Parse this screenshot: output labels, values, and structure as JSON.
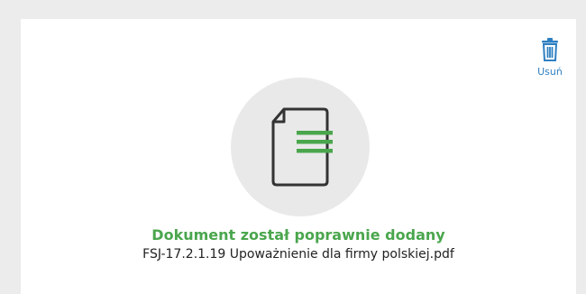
{
  "upload_card": {
    "delete_label": "Usuń",
    "delete_icon": "trash-icon",
    "document_icon": "document-icon",
    "status_text": "Dokument został poprawnie dodany",
    "file_name": "FSJ-17.2.1.19 Upoważnienie dla firmy polskiej.pdf"
  },
  "colors": {
    "accent_blue": "#2e7fc1",
    "success_green": "#4aa64d",
    "circle_bg": "#e9e9e9",
    "icon_dark": "#333333"
  }
}
